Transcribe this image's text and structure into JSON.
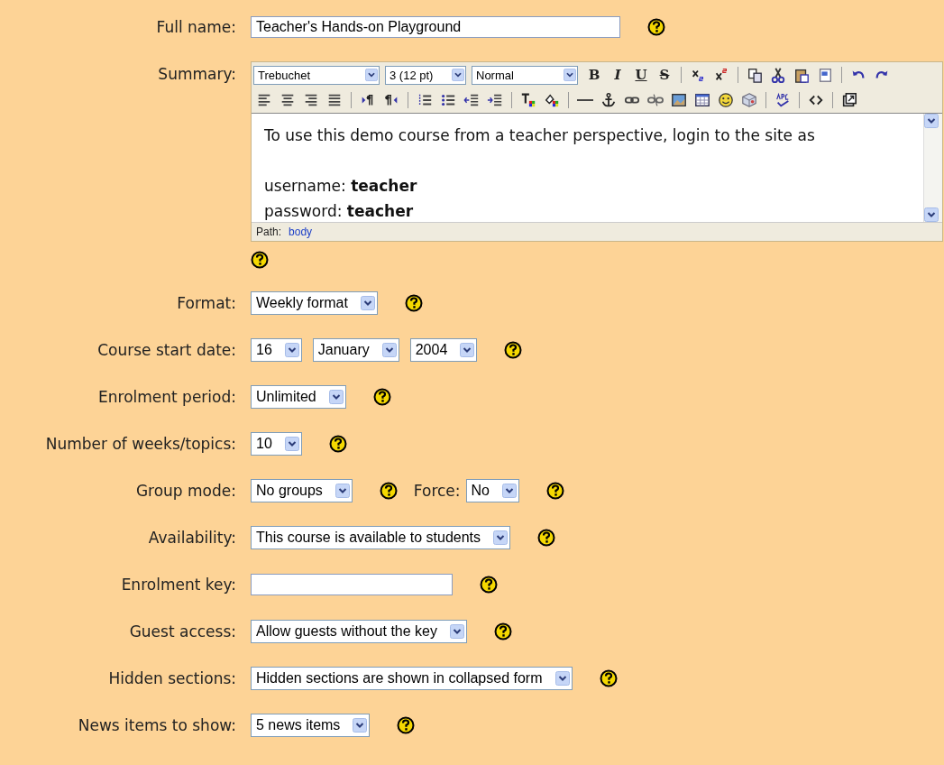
{
  "fields": [
    {
      "kind": "text",
      "label": "Full name:",
      "value": "Teacher's Hands-on Playground"
    },
    {
      "kind": "editor",
      "label": "Summary:",
      "toolbar": {
        "font": "Trebuchet",
        "size": "3 (12 pt)",
        "style": "Normal",
        "format_buttons": [
          "B",
          "I",
          "U",
          "S"
        ]
      },
      "content": [
        "To use this demo course from a teacher perspective, login to the site as",
        "username: **teacher**",
        "password: **teacher**"
      ],
      "path_label": "Path:",
      "path_link": "body"
    },
    {
      "kind": "select",
      "label": "Format:",
      "selects": [
        "Weekly format"
      ]
    },
    {
      "kind": "select",
      "label": "Course start date:",
      "selects": [
        "16",
        "January",
        "2004"
      ]
    },
    {
      "kind": "select",
      "label": "Enrolment period:",
      "selects": [
        "Unlimited"
      ]
    },
    {
      "kind": "select",
      "label": "Number of weeks/topics:",
      "selects": [
        "10"
      ]
    },
    {
      "kind": "select",
      "label": "Group mode:",
      "selects": [
        "No groups"
      ],
      "extra_label": "Force:",
      "extra_select": "No"
    },
    {
      "kind": "select",
      "label": "Availability:",
      "selects": [
        "This course is available to students"
      ]
    },
    {
      "kind": "text",
      "label": "Enrolment key:"
    },
    {
      "kind": "select",
      "label": "Guest access:",
      "selects": [
        "Allow guests without the key"
      ]
    },
    {
      "kind": "select",
      "label": "Hidden sections:",
      "selects": [
        "Hidden sections are shown in collapsed form"
      ]
    },
    {
      "kind": "select",
      "label": "News items to show:",
      "selects": [
        "5 news items"
      ]
    }
  ]
}
